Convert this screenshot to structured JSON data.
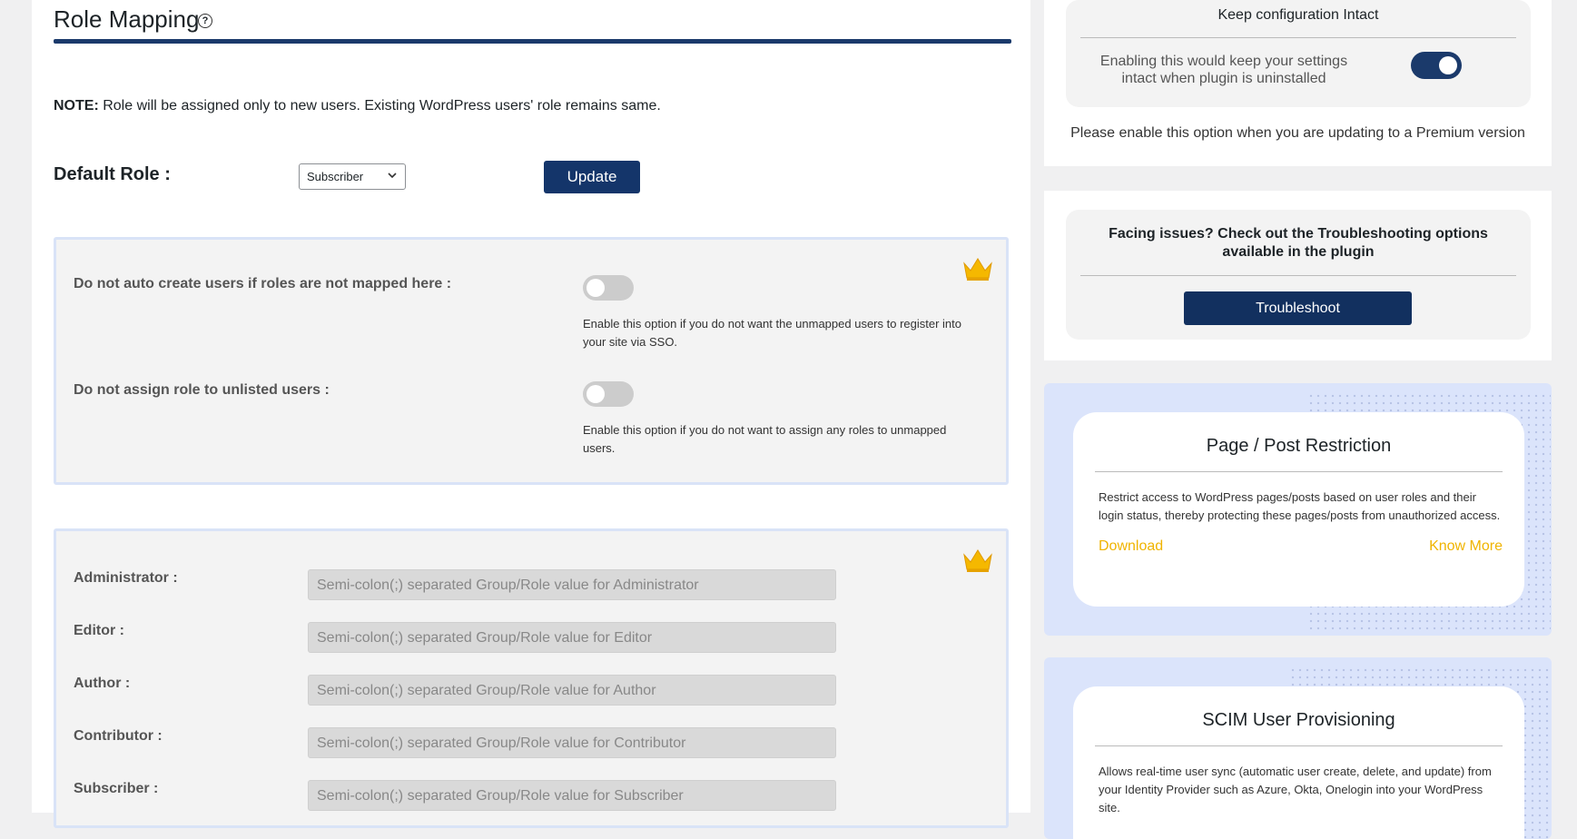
{
  "main": {
    "title": "Role Mapping",
    "help_glyph": "?",
    "note_bold": "NOTE:",
    "note_text": " Role will be assigned only to new users. Existing WordPress users' role remains same.",
    "default_role_label": "Default Role :",
    "default_role_value": "Subscriber",
    "update_label": "Update",
    "options": [
      {
        "label": "Do not auto create users if roles are not mapped here :",
        "desc": "Enable this option if you do not want the unmapped users to register into your site via SSO.",
        "enabled": false
      },
      {
        "label": "Do not assign role to unlisted users :",
        "desc": "Enable this option if you do not want to assign any roles to unmapped users.",
        "enabled": false
      }
    ],
    "mappings": [
      {
        "label": "Administrator :",
        "placeholder": "Semi-colon(;) separated Group/Role value for Administrator"
      },
      {
        "label": "Editor :",
        "placeholder": "Semi-colon(;) separated Group/Role value for Editor"
      },
      {
        "label": "Author :",
        "placeholder": "Semi-colon(;) separated Group/Role value for Author"
      },
      {
        "label": "Contributor :",
        "placeholder": "Semi-colon(;) separated Group/Role value for Contributor"
      },
      {
        "label": "Subscriber :",
        "placeholder": "Semi-colon(;) separated Group/Role value for Subscriber"
      }
    ]
  },
  "sidebar": {
    "keep_config": {
      "title": "Keep configuration Intact",
      "text": "Enabling this would keep your settings intact when plugin is uninstalled",
      "enabled": true,
      "premium_note": "Please enable this option when you are updating to a Premium version"
    },
    "troubleshoot": {
      "title": "Facing issues? Check out the Troubleshooting options available in the plugin",
      "button": "Troubleshoot"
    },
    "promos": [
      {
        "title": "Page / Post Restriction",
        "desc": "Restrict access to WordPress pages/posts based on user roles and their login status, thereby protecting these pages/posts from unauthorized access.",
        "download": "Download",
        "know_more": "Know More"
      },
      {
        "title": "SCIM User Provisioning",
        "desc": "Allows real-time user sync (automatic user create, delete, and update) from your Identity Provider such as Azure, Okta, Onelogin into your WordPress site."
      }
    ]
  },
  "colors": {
    "primary": "#1b3a6b",
    "link": "#f0b400",
    "crown": "#f5b800"
  },
  "icons": {
    "crown": "crown-icon",
    "help": "help-circle-icon",
    "chevron": "chevron-down-icon"
  }
}
